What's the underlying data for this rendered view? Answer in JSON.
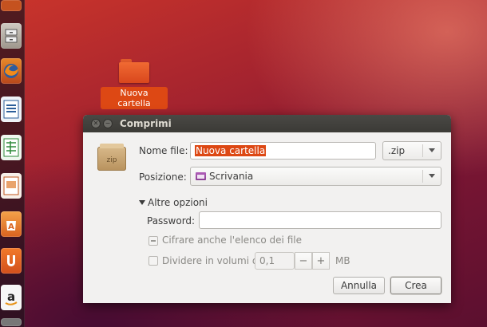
{
  "desktop": {
    "folder_label": "Nuova cartella"
  },
  "launcher": {
    "items": [
      {
        "icon": "file-cabinet-icon"
      },
      {
        "icon": "firefox-icon"
      },
      {
        "icon": "writer-icon"
      },
      {
        "icon": "calc-icon"
      },
      {
        "icon": "impress-icon"
      },
      {
        "icon": "software-center-icon"
      },
      {
        "icon": "ubuntu-one-icon"
      },
      {
        "icon": "amazon-icon"
      }
    ]
  },
  "dialog": {
    "title": "Comprimi",
    "icon_text": "zip",
    "filename_label": "Nome file:",
    "filename_value": "Nuova cartella",
    "extension_value": ".zip",
    "location_label": "Posizione:",
    "location_value": "Scrivania",
    "expander_label": "Altre opzioni",
    "password_label": "Password:",
    "password_value": "",
    "encrypt_label": "Cifrare anche l'elenco dei file",
    "split_label": "Dividere in volumi da",
    "volume_value": "0,1",
    "minus": "−",
    "plus": "+",
    "unit": "MB",
    "cancel_label": "Annulla",
    "create_label": "Crea"
  },
  "colors": {
    "accent": "#dd4814",
    "titlebar": "#3b3a36",
    "dialog_bg": "#f2f1f0"
  }
}
